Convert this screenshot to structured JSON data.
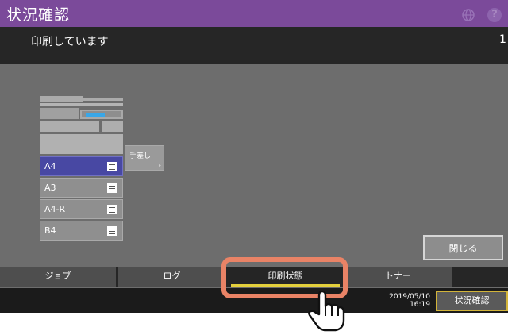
{
  "header": {
    "title": "状況確認",
    "status_message": "印刷しています",
    "page_counter": "1",
    "help_glyph": "?"
  },
  "machine": {
    "bypass_tray_label": "手差し",
    "bypass_arrow": "▸",
    "drawers": [
      {
        "label": "A4",
        "selected": true
      },
      {
        "label": "A3",
        "selected": false
      },
      {
        "label": "A4-R",
        "selected": false
      },
      {
        "label": "B4",
        "selected": false
      }
    ]
  },
  "close_button_label": "閉じる",
  "tabs": [
    {
      "label": "ジョブ"
    },
    {
      "label": "ログ"
    },
    {
      "label": "印刷状態"
    },
    {
      "label": "トナー"
    }
  ],
  "active_tab": "印刷状態",
  "footer": {
    "date": "2019/05/10",
    "time": "16:19",
    "status_button_label": "状況確認"
  },
  "icons": {
    "globe": "globe-icon",
    "help": "help-icon",
    "drawer": "paper-list-icon",
    "cursor": "hand-pointer-icon"
  },
  "colors": {
    "title_bar": "#7b4a9a",
    "selected_drawer": "#4848a3",
    "active_tab_underline": "#e3cf3c",
    "status_button_border": "#d2b43a",
    "callout_highlight": "#e98366",
    "toner_display": "#39a7e8"
  }
}
